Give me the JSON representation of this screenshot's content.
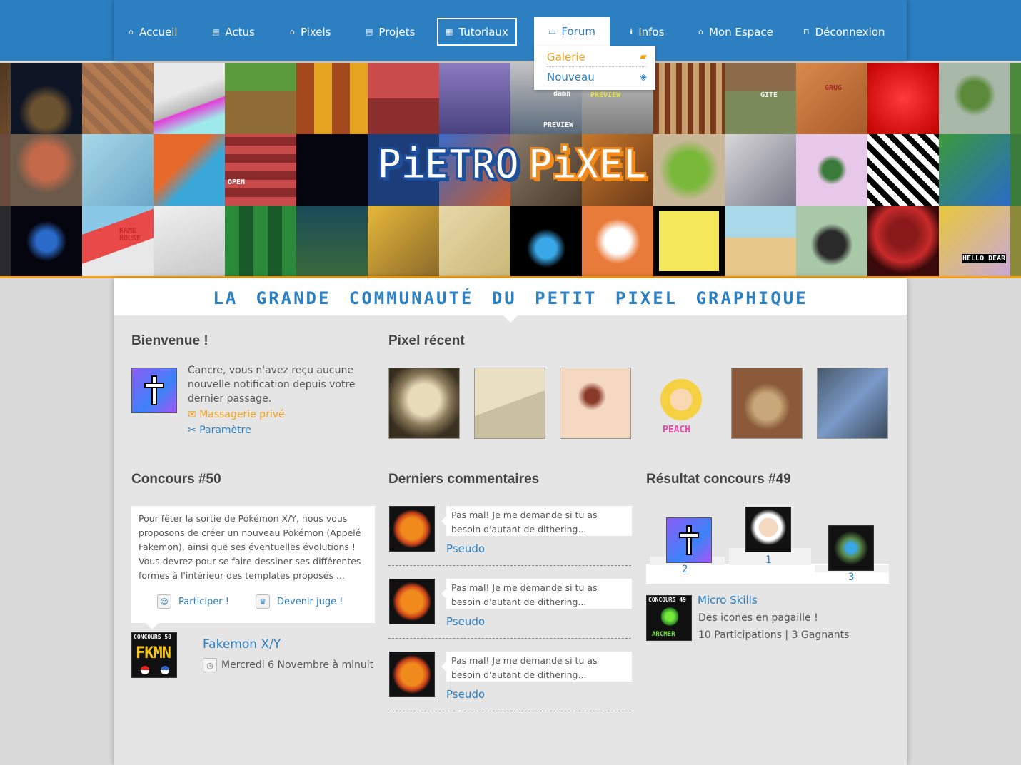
{
  "nav": {
    "items": [
      {
        "label": "Accueil",
        "icon": "home-icon"
      },
      {
        "label": "Actus",
        "icon": "document-icon"
      },
      {
        "label": "Pixels",
        "icon": "home-icon"
      },
      {
        "label": "Projets",
        "icon": "document-icon"
      },
      {
        "label": "Tutoriaux",
        "icon": "book-icon"
      },
      {
        "label": "Forum",
        "icon": "chat-icon"
      },
      {
        "label": "Infos",
        "icon": "info-icon"
      },
      {
        "label": "Mon Espace",
        "icon": "home-icon"
      },
      {
        "label": "Déconnexion",
        "icon": "unlock-icon"
      }
    ]
  },
  "dropdown": {
    "items": [
      {
        "label": "Galerie",
        "icon": "box-icon"
      },
      {
        "label": "Nouveau",
        "icon": "cube-icon"
      }
    ]
  },
  "banner": {
    "logo_part1": "PiETRO",
    "logo_part2": "PiXEL",
    "tile_labels": {
      "damn": "damn",
      "preview": "PREVIEW",
      "preview2": "PREVIEW",
      "gite": "GITE",
      "grug": "GRUG",
      "open": "OPEN",
      "kame": "KAME HOUSE",
      "hello": "HELLO DEAR"
    }
  },
  "tagline": "LA GRANDE COMMUNAUTÉ DU PETIT PIXEL GRAPHIQUE",
  "welcome": {
    "title": "Bienvenue !",
    "message": "Cancre, vous n'avez reçu aucune nouvelle notification depuis votre dernier passage.",
    "messaging_link": "Massagerie privé",
    "settings_link": "Paramètre"
  },
  "recent": {
    "title": "Pixel récent",
    "peach_label": "PEACH"
  },
  "contest": {
    "title": "Concours #50",
    "description": "Pour fêter la sortie de Pokémon X/Y, nous vous proposons de créer un nouveau Pokémon (Appelé Fakemon), ainsi que ses éventuelles évolutions ! Vous devrez pour se faire dessiner ses différentes formes à l'intérieur des templates proposés ...",
    "participate": "Participer !",
    "judge": "Devenir juge !",
    "badge_top": "CONCOURS 50",
    "badge_text": "FKMN",
    "name": "Fakemon X/Y",
    "date": "Mercredi 6 Novembre à minuit"
  },
  "comments": {
    "title": "Derniers commentaires",
    "items": [
      {
        "text": "Pas mal! Je me demande si tu as besoin d'autant de dithering...",
        "author": "Pseudo"
      },
      {
        "text": "Pas mal! Je me demande si tu as besoin d'autant de dithering...",
        "author": "Pseudo"
      },
      {
        "text": "Pas mal! Je me demande si tu as besoin d'autant de dithering...",
        "author": "Pseudo"
      }
    ]
  },
  "results": {
    "title": "Résultat concours #49",
    "places": [
      "2",
      "1",
      "3"
    ],
    "badge_top": "CONCOURS 49",
    "badge_text": "ARCMER",
    "name": "Micro Skills",
    "description": "Des icones en pagaille !",
    "stats": "10 Participations | 3 Gagnants"
  },
  "colors": {
    "brand_blue": "#2c7fc0",
    "accent_orange": "#f5a21b",
    "background": "#e5e5e5"
  }
}
